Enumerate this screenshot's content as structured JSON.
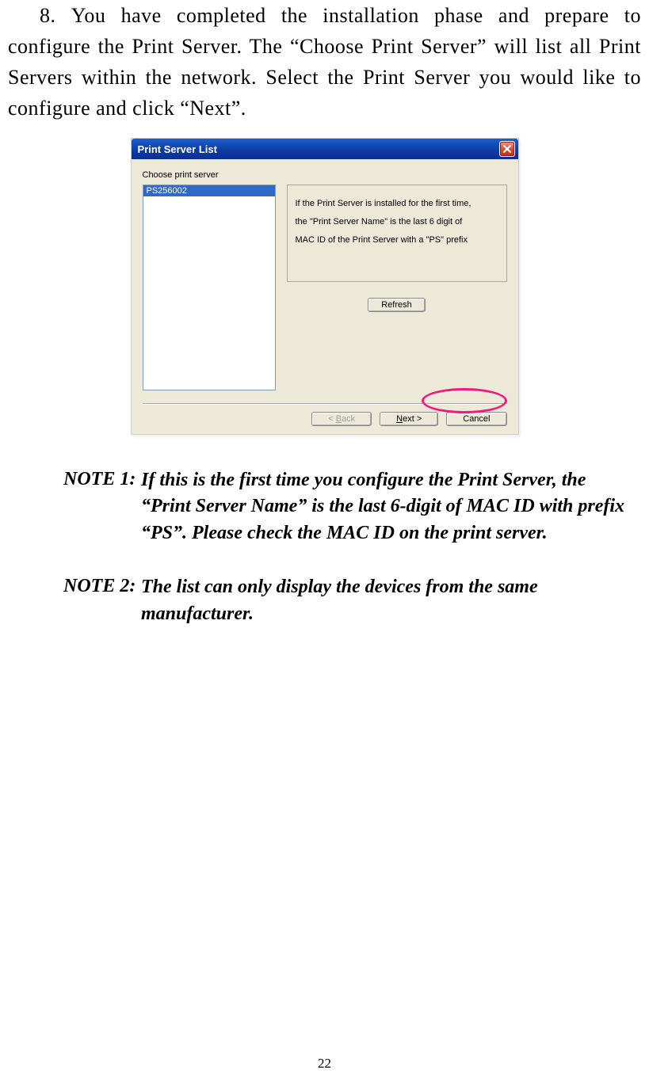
{
  "step": {
    "number": "8.",
    "text": "You have completed the installation phase and prepare to configure the Print Server. The “Choose Print Server” will list all Print Servers within the network. Select the Print Server you would like to configure and click “Next”."
  },
  "dialog": {
    "title": "Print Server List",
    "choose_label": "Choose print server",
    "list_item": "PS256002",
    "info_line1": "If the Print Server is installed for the first time,",
    "info_line2": "the \"Print Server Name\" is the last 6 digit of",
    "info_line3": "MAC ID of the Print Server with a \"PS\" prefix",
    "refresh": "Refresh",
    "back": "< Back",
    "next_prefix": "N",
    "next_rest": "ext >",
    "cancel": "Cancel"
  },
  "notes": {
    "n1_label": "NOTE 1:",
    "n1_body": "If this is the first time you configure the Print Server, the “Print Server Name” is the last 6-digit of MAC ID with prefix “PS”. Please check the MAC ID on the print server.",
    "n2_label": "NOTE 2:",
    "n2_body": "The list can only display the devices from the same manufacturer."
  },
  "page_number": "22"
}
